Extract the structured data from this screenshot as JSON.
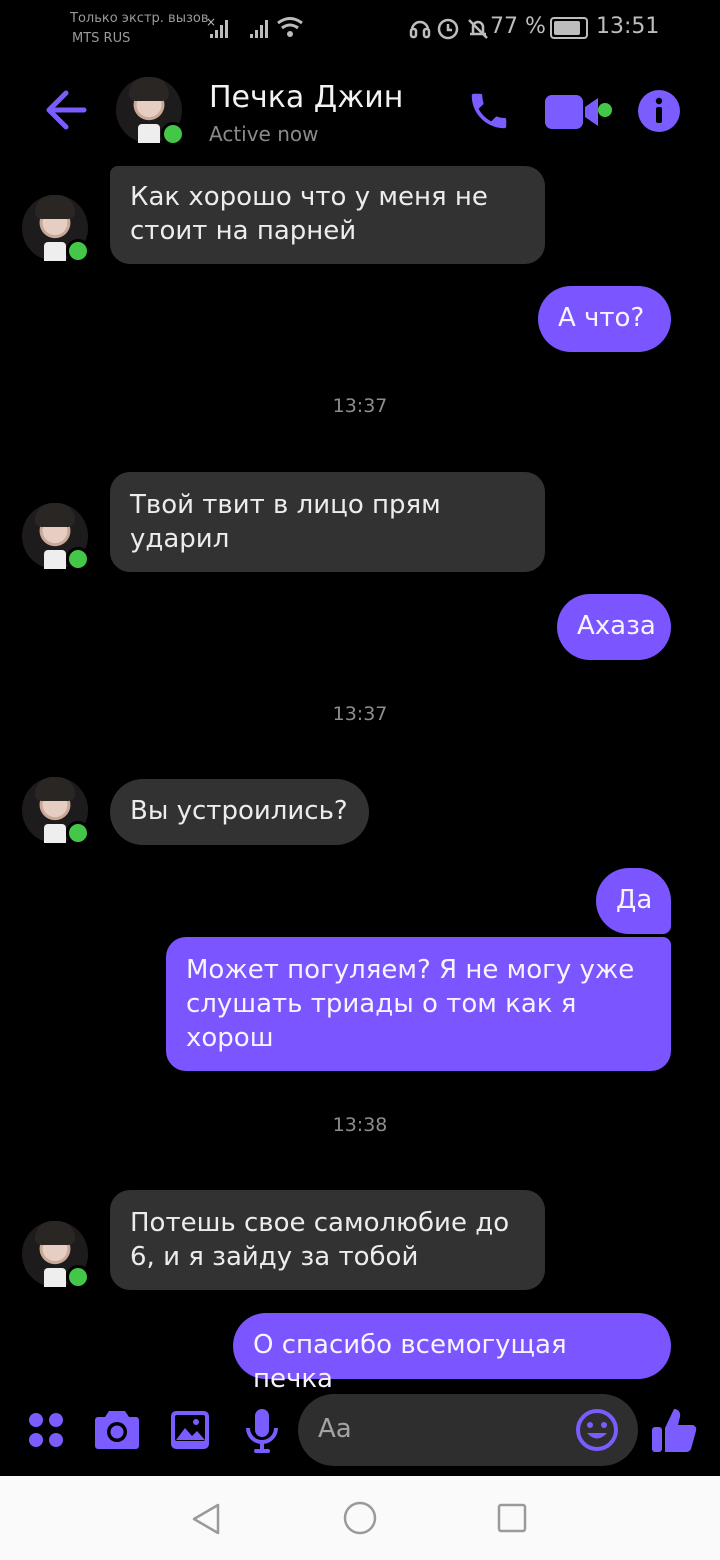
{
  "status_bar": {
    "carrier_line1": "Только экстр. вызов",
    "carrier_line2": "MTS RUS",
    "battery": "77 %",
    "time": "13:51"
  },
  "header": {
    "contact_name": "Печка Джин",
    "status": "Active now",
    "accent_color": "#7b5cff"
  },
  "messages": [
    {
      "from": "contact",
      "text_lines": [
        "Как хорошо что у меня не",
        "стоит на парней"
      ]
    },
    {
      "from": "me",
      "text": "А что?"
    },
    {
      "timestamp": "13:37"
    },
    {
      "from": "contact",
      "text_lines": [
        "Твой твит в лицо прям",
        "ударил"
      ]
    },
    {
      "from": "me",
      "text": "Ахаза"
    },
    {
      "timestamp": "13:37"
    },
    {
      "from": "contact",
      "text": "Вы устроились?"
    },
    {
      "from": "me",
      "text": "Да"
    },
    {
      "from": "me",
      "text_lines": [
        "Может погуляем? Я не могу уже",
        "слушать триады о том как я",
        "хорош"
      ]
    },
    {
      "timestamp": "13:38"
    },
    {
      "from": "contact",
      "text_lines": [
        "Потешь свое самолюбие до",
        "6, и я зайду за тобой"
      ]
    },
    {
      "from": "me",
      "text": "О спасибо всемогущая печка"
    }
  ],
  "composer": {
    "placeholder": "Aa"
  },
  "icons": [
    "back-arrow-icon",
    "phone-icon",
    "video-icon",
    "info-icon",
    "apps-icon",
    "camera-icon",
    "gallery-icon",
    "microphone-icon",
    "emoji-icon",
    "thumbs-up-icon",
    "nav-back-icon",
    "nav-home-icon",
    "nav-recents-icon"
  ]
}
